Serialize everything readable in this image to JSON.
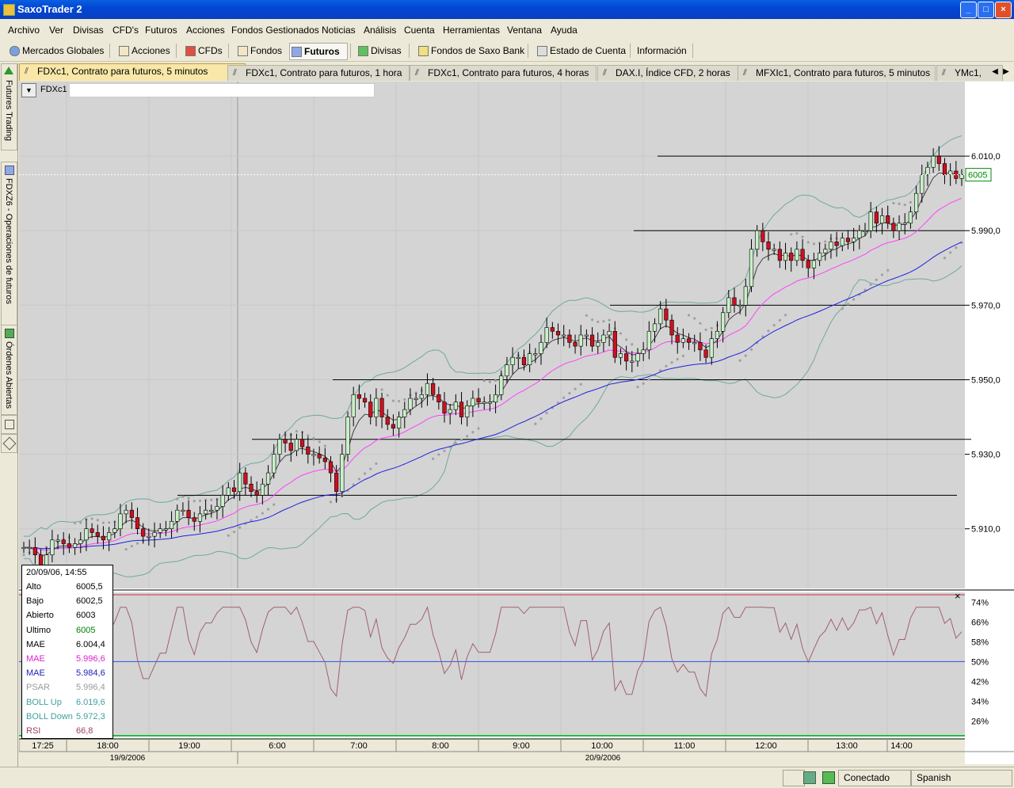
{
  "window": {
    "title": "SaxoTrader 2",
    "min_icon": "minimize-icon",
    "max_icon": "maximize-icon",
    "close_icon": "close-icon"
  },
  "menu": [
    "Archivo",
    "Ver",
    "Divisas",
    "CFD's",
    "Futuros",
    "Acciones",
    "Fondos Gestionados",
    "Noticias",
    "Análisis",
    "Cuenta",
    "Herramientas",
    "Ventana",
    "Ayuda"
  ],
  "toolbar": [
    {
      "label": "Mercados Globales",
      "icon": "globe-icon"
    },
    {
      "label": "Acciones",
      "icon": "stocks-icon"
    },
    {
      "label": "CFDs",
      "icon": "cfd-icon"
    },
    {
      "label": "Fondos",
      "icon": "funds-icon"
    },
    {
      "label": "Futuros",
      "icon": "futures-icon",
      "active": true
    },
    {
      "label": "Divisas",
      "icon": "fx-icon"
    },
    {
      "label": "Fondos de Saxo Bank",
      "icon": "saxo-funds-icon"
    },
    {
      "label": "Estado de Cuenta",
      "icon": "account-icon"
    },
    {
      "label": "Información",
      "icon": ""
    }
  ],
  "chart_tabs": [
    {
      "label": "FDXc1, Contrato para futuros, 5 minutos",
      "active": true
    },
    {
      "label": "FDXc1, Contrato para futuros, 1 hora"
    },
    {
      "label": "FDXc1, Contrato para futuros, 4 horas"
    },
    {
      "label": "DAX.I, Índice CFD, 2 horas"
    },
    {
      "label": "MFXIc1, Contrato para futuros, 5 minutos"
    },
    {
      "label": "YMc1,"
    }
  ],
  "left_tabs": [
    "Futures Trading",
    "FDXZ6 - Operaciones de futuros",
    "Órdenes Abiertas"
  ],
  "symbol": "FDXc1",
  "info": {
    "datetime": "20/09/06, 14:55",
    "rows": [
      {
        "k": "Alto",
        "v": "6005,5",
        "color": "#000000"
      },
      {
        "k": "Bajo",
        "v": "6002,5",
        "color": "#000000"
      },
      {
        "k": "Abierto",
        "v": "6003",
        "color": "#000000"
      },
      {
        "k": "Ultimo",
        "v": "6005",
        "color": "#008000",
        "kcolor": "#000000"
      },
      {
        "k": "MAE",
        "v": "6.004,4",
        "color": "#000000"
      },
      {
        "k": "MAE",
        "v": "5.996,6",
        "color": "#e020d0"
      },
      {
        "k": "MAE",
        "v": "5.984,6",
        "color": "#2020c0"
      },
      {
        "k": "PSAR",
        "v": "5.996,4",
        "color": "#9a9a9a"
      },
      {
        "k": "BOLL Up",
        "v": "6.019,6",
        "color": "#40a0a0"
      },
      {
        "k": "BOLL Down",
        "v": "5.972,3",
        "color": "#40a0a0"
      },
      {
        "k": "RSI",
        "v": "66,8",
        "color": "#a04060"
      }
    ]
  },
  "colors": {
    "up": "#c8f0c8",
    "down": "#cc1020",
    "mae_fast": "#404040",
    "mae_mid": "#ff40ff",
    "mae_slow": "#2020e0",
    "psar": "#a0a0a0",
    "boll": "#70a8a0",
    "rsi": "#a06070",
    "grid": "#c8c8c8"
  },
  "status": {
    "connection": "Conectado",
    "language": "Spanish"
  },
  "chart_data": {
    "type": "candlestick",
    "ylim": [
      5894,
      6030
    ],
    "yticks": [
      "6.010,0",
      "5.990,0",
      "5.970,0",
      "5.950,0",
      "5.930,0",
      "5.910,0"
    ],
    "last_price": "6005",
    "x_labels": [
      "17:25",
      "18:00",
      "19:00",
      "6:00",
      "7:00",
      "8:00",
      "9:00",
      "10:00",
      "11:00",
      "12:00",
      "13:00",
      "14:00"
    ],
    "date_labels": [
      "19/9/2006",
      "20/9/2006"
    ],
    "horizontal_lines": [
      6010,
      5990,
      5970,
      5950,
      5934,
      5919
    ],
    "rsi": {
      "ylim": [
        20,
        78
      ],
      "ticks": [
        "74%",
        "66%",
        "58%",
        "50%",
        "42%",
        "34%",
        "26%"
      ]
    },
    "close": [
      5905,
      5905,
      5903,
      5900,
      5903,
      5907,
      5907,
      5906,
      5905,
      5906,
      5907,
      5910,
      5909,
      5908,
      5907,
      5909,
      5910,
      5914,
      5915,
      5913,
      5910,
      5908,
      5908,
      5909,
      5910,
      5910,
      5912,
      5915,
      5915,
      5913,
      5912,
      5914,
      5915,
      5915,
      5916,
      5919,
      5921,
      5920,
      5925,
      5922,
      5920,
      5919,
      5922,
      5925,
      5930,
      5934,
      5933,
      5931,
      5934,
      5932,
      5930,
      5930,
      5929,
      5928,
      5925,
      5920,
      5930,
      5940,
      5946,
      5945,
      5944,
      5940,
      5945,
      5940,
      5938,
      5937,
      5940,
      5942,
      5945,
      5945,
      5946,
      5949,
      5946,
      5944,
      5941,
      5942,
      5944,
      5940,
      5943,
      5945,
      5944,
      5944,
      5944,
      5946,
      5951,
      5954,
      5956,
      5956,
      5954,
      5957,
      5957,
      5960,
      5964,
      5963,
      5962,
      5962,
      5960,
      5959,
      5962,
      5962,
      5959,
      5960,
      5962,
      5963,
      5956,
      5957,
      5955,
      5955,
      5957,
      5958,
      5963,
      5965,
      5969,
      5966,
      5962,
      5960,
      5961,
      5960,
      5960,
      5958,
      5956,
      5961,
      5963,
      5968,
      5972,
      5970,
      5970,
      5975,
      5985,
      5990,
      5987,
      5985,
      5985,
      5982,
      5984,
      5982,
      5985,
      5982,
      5980,
      5982,
      5984,
      5985,
      5987,
      5986,
      5988,
      5987,
      5988,
      5990,
      5990,
      5995,
      5992,
      5994,
      5992,
      5990,
      5992,
      5992,
      5995,
      6000,
      6005,
      6007,
      6010,
      6008,
      6005,
      6006,
      6004,
      6005
    ]
  }
}
